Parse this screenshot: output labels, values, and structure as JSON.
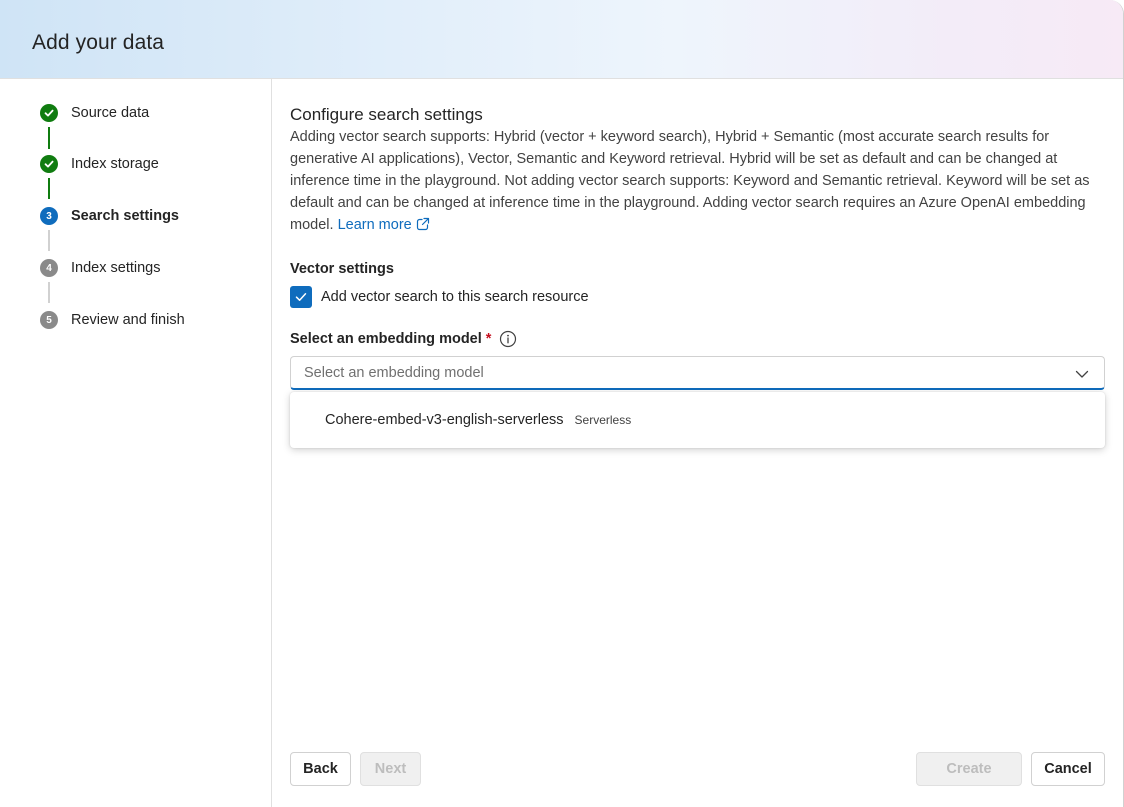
{
  "header": {
    "title": "Add your data"
  },
  "steps": [
    {
      "label": "Source data",
      "state": "done"
    },
    {
      "label": "Index storage",
      "state": "done"
    },
    {
      "label": "Search settings",
      "state": "current",
      "number": "3"
    },
    {
      "label": "Index settings",
      "state": "todo",
      "number": "4"
    },
    {
      "label": "Review and finish",
      "state": "todo",
      "number": "5"
    }
  ],
  "main": {
    "title": "Configure search settings",
    "description": "Adding vector search supports: Hybrid (vector + keyword search), Hybrid + Semantic (most accurate search results for generative AI applications), Vector, Semantic and Keyword retrieval. Hybrid will be set as default and can be changed at inference time in the playground. Not adding vector search supports: Keyword and Semantic retrieval. Keyword will be set as default and can be changed at inference time in the playground. Adding vector search requires an Azure OpenAI embedding model.",
    "learn_more": "Learn more",
    "vector_settings_label": "Vector settings",
    "vector_checkbox_label": "Add vector search to this search resource",
    "vector_checkbox_checked": true,
    "embedding_label": "Select an embedding model",
    "required_mark": "*",
    "embedding_placeholder": "Select an embedding model",
    "options": [
      {
        "name": "Cohere-embed-v3-english-serverless",
        "tag": "Serverless"
      }
    ]
  },
  "footer": {
    "back": "Back",
    "next": "Next",
    "create": "Create",
    "cancel": "Cancel"
  },
  "colors": {
    "accent": "#0f6cbd",
    "success": "#107c10",
    "required": "#c50f1f"
  }
}
